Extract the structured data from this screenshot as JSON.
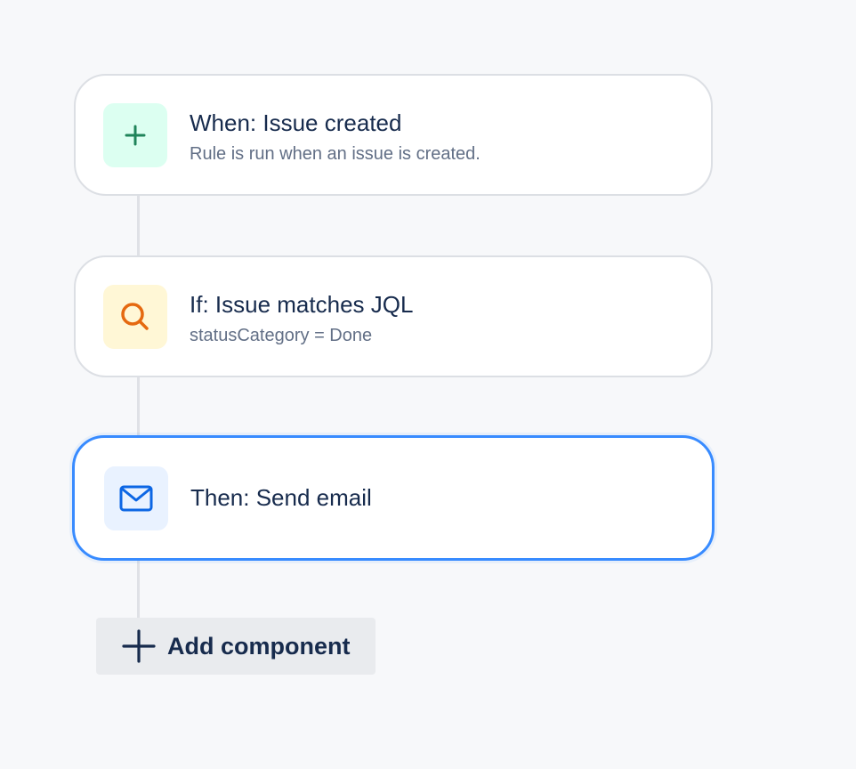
{
  "rule": {
    "steps": [
      {
        "kind": "trigger",
        "title": "When: Issue created",
        "subtitle": "Rule is run when an issue is created.",
        "icon": "plus-icon",
        "icon_color": "#1f845a",
        "icon_bg": "#dcfff1"
      },
      {
        "kind": "condition",
        "title": "If: Issue matches JQL",
        "subtitle": "statusCategory = Done",
        "icon": "search-icon",
        "icon_color": "#e56910",
        "icon_bg": "#fff7d6"
      },
      {
        "kind": "action",
        "title": "Then: Send email",
        "icon": "mail-icon",
        "icon_color": "#0c66e4",
        "icon_bg": "#e9f2ff",
        "selected": true
      }
    ],
    "add_button": {
      "label": "Add component",
      "icon": "plus-icon"
    }
  },
  "colors": {
    "background": "#f7f8fa",
    "selected_border": "#388bff",
    "text_primary": "#172b4d",
    "text_subtle": "#626f86"
  }
}
